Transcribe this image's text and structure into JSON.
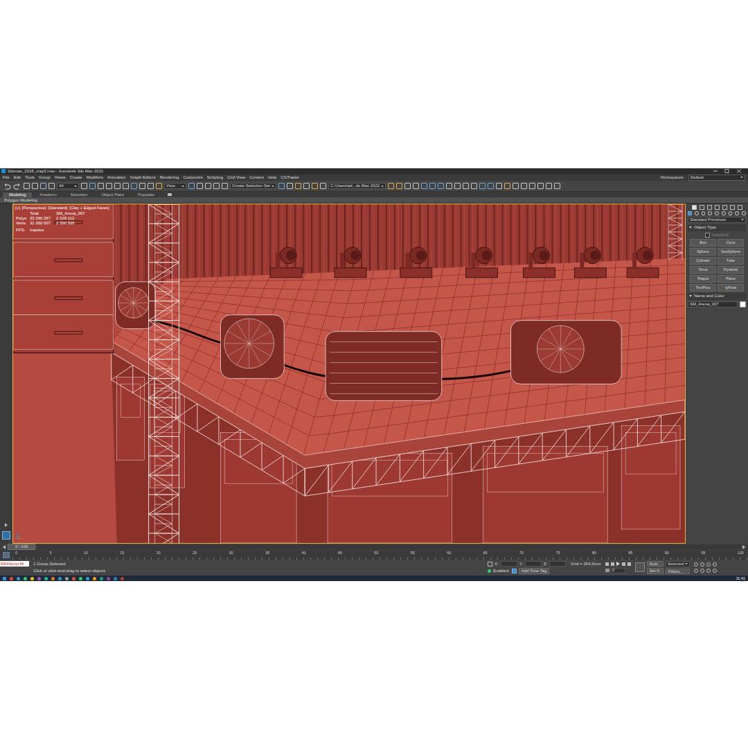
{
  "window": {
    "title": "3dsmax_2018_vray5.max - Autodesk 3ds Max 2022"
  },
  "menu": [
    "File",
    "Edit",
    "Tools",
    "Group",
    "Views",
    "Create",
    "Modifiers",
    "Animation",
    "Graph Editors",
    "Rendering",
    "Customize",
    "Scripting",
    "Civil View",
    "Content",
    "Help",
    "CGTrader"
  ],
  "workspaces": {
    "label": "Workspaces:",
    "value": "Default"
  },
  "toolbar": {
    "filter": "All",
    "view": "View",
    "selection_set": "Create Selection Set",
    "path": "C:\\Users\\ad...ds Max 2022"
  },
  "ribbon": {
    "tabs": [
      {
        "label": "Modeling",
        "selected": true
      },
      {
        "label": "Freeform",
        "selected": false
      },
      {
        "label": "Selection",
        "selected": false
      },
      {
        "label": "Object Paint",
        "selected": false
      },
      {
        "label": "Populate",
        "selected": false
      }
    ],
    "panel": "Polygon Modeling"
  },
  "viewport": {
    "labels": [
      "[+]",
      "[Perspective]",
      "[Standard]",
      "[Clay + Edged Faces]"
    ],
    "stats": {
      "header": [
        "Total",
        "SM_Arena_007"
      ],
      "rows": [
        {
          "label": "Polys:",
          "total": "33 266 287",
          "selected": "2 228 112"
        },
        {
          "label": "Verts:",
          "total": "31 360 007",
          "selected": "2 396 936"
        }
      ],
      "fps": {
        "label": "FPS:",
        "value": "Inactive"
      }
    }
  },
  "command_panel": {
    "dropdown": "Standard Primitives",
    "object_type": "Object Type",
    "autogrid": {
      "label": "AutoGrid",
      "checked": false
    },
    "buttons": [
      "Box",
      "Cone",
      "Sphere",
      "GeoSphere",
      "Cylinder",
      "Tube",
      "Torus",
      "Pyramid",
      "Teapot",
      "Plane",
      "TextPlus",
      "tyFlow"
    ],
    "name_and_color": "Name and Color",
    "name": "SM_Arena_007",
    "swatch": "#ffffff"
  },
  "timeline": {
    "frame": "0 / 100",
    "ticks": [
      "0",
      "5",
      "10",
      "15",
      "20",
      "25",
      "30",
      "35",
      "40",
      "45",
      "50",
      "55",
      "60",
      "65",
      "70",
      "75",
      "80",
      "85",
      "90",
      "95",
      "100"
    ]
  },
  "status": {
    "maxscript": "MAXScript Mi",
    "selection": "1 Group Selected",
    "prompt": "Click or click-and-drag to select objects",
    "coords": [
      "X:",
      "Y:",
      "Z:"
    ],
    "grid": "Grid = 254,0mm",
    "enabled": {
      "label": "Enabled:",
      "checked": true
    },
    "add_time_tag": "Add Time Tag",
    "key_mode": "Auto",
    "key_filter": "Selected",
    "set_key": "Set K.",
    "filters": "Filters...",
    "frame": "0"
  },
  "taskbar": {
    "time": "11:41"
  }
}
